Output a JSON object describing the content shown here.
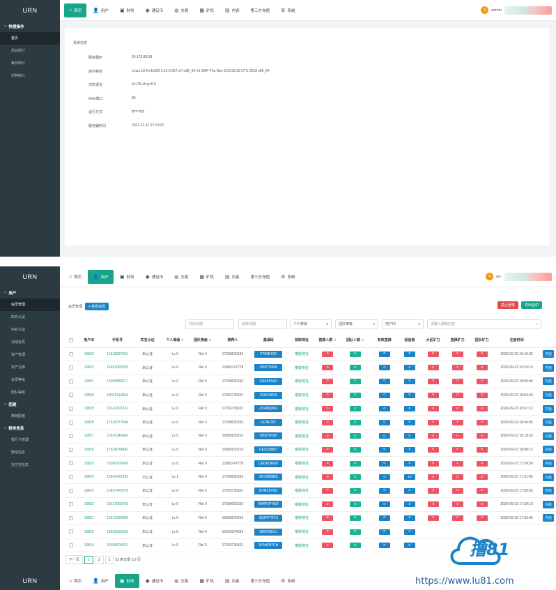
{
  "brand": "URN",
  "nav_tabs": [
    {
      "label": "首页",
      "icon": "home-icon"
    },
    {
      "label": "用户",
      "icon": "user-icon"
    },
    {
      "label": "财务",
      "icon": "finance-icon"
    },
    {
      "label": "通证币",
      "icon": "database-icon"
    },
    {
      "label": "交易",
      "icon": "exchange-icon"
    },
    {
      "label": "矿机",
      "icon": "table-icon"
    },
    {
      "label": "内容",
      "icon": "list-icon"
    },
    {
      "label": "第三方充值",
      "icon": ""
    },
    {
      "label": "系统",
      "icon": "gear-icon"
    }
  ],
  "user": {
    "name_1": "admin",
    "name_2": "ad-",
    "avatar": "a"
  },
  "sidebar_1": {
    "group": "快捷操作",
    "items": [
      "首页",
      "后台统计",
      "每日统计",
      "币种统计"
    ]
  },
  "sidebar_2": {
    "groups": [
      {
        "title": "用户",
        "items": [
          "会员管理",
          "四办认证",
          "实名认证",
          "冻结会员",
          "资产管理",
          "资产兑换",
          "会员等级",
          "团队等级"
        ]
      },
      {
        "title": "团建",
        "items": [
          "推荐图谱"
        ]
      },
      {
        "title": "财务信息",
        "items": [
          "银行卡管理",
          "微信信息",
          "支付宝信息"
        ]
      }
    ]
  },
  "system_info": {
    "title": "系统信息",
    "rows": [
      {
        "label": "服务器IP",
        "value": "59.176.89.58"
      },
      {
        "label": "操作系统",
        "value": "Linux 10-0-nfo025 3.10.0-957.el7.x86_64 #1 SMP Thu Nov 8 23:39:32 UTC 2018 x86_64"
      },
      {
        "label": "浏览语言",
        "value": "zh-CN,zh;q=0.9"
      },
      {
        "label": "Web端口",
        "value": "80"
      },
      {
        "label": "运行方式",
        "value": "fpm-fcgi"
      },
      {
        "label": "服务器时间",
        "value": "2021-01-11 17:13:02"
      }
    ]
  },
  "members": {
    "breadcrumb": "会员管理",
    "add_label": "新增会员",
    "ban_label": "禁止登录",
    "export_label": "导出选中",
    "filters": {
      "start_date": "开始日期",
      "end_date": "结束日期",
      "level": "个人等级",
      "team_level": "团队等级",
      "user_id": "用户ID",
      "search": "请输入搜索内容"
    },
    "columns": [
      "用户ID",
      "手机号",
      "实名认证",
      "个人等级",
      "团队等级",
      "推荐人",
      "邀请码",
      "领取地址",
      "直推人数",
      "团队人数",
      "有效直推",
      "经验值",
      "大区矿力",
      "直推矿力",
      "团队矿力",
      "注册时间"
    ],
    "op_label": "开启",
    "rows": [
      {
        "id": "10833",
        "phone": "13128887963",
        "auth": "未认证",
        "lv": "Lv 0",
        "team": "Rel 0",
        "ref": "17339000166",
        "code": "P769NICR",
        "addr": "複製地址",
        "a": "0",
        "b": "0",
        "c": "0",
        "d": "0",
        "e": "0",
        "f": "0",
        "g": "0",
        "time": "2020-09-23 19:43:32"
      },
      {
        "id": "10832",
        "phone": "15392090235",
        "auth": "未认证",
        "lv": "Lv 0",
        "team": "Rel 0",
        "ref": "13383747778",
        "code": "5I5PTI0RB",
        "addr": "複製地址",
        "a": "0",
        "b": "0",
        "c": "0",
        "d": "0",
        "e": "0",
        "f": "0",
        "g": "0",
        "time": "2020-09-23 19:24:15"
      },
      {
        "id": "10831",
        "phone": "13099885617",
        "auth": "未认证",
        "lv": "Lv 0",
        "team": "Rel 0",
        "ref": "17339000166",
        "code": "G8AZ5SA2",
        "addr": "複製地址",
        "a": "0",
        "b": "0",
        "c": "0",
        "d": "0",
        "e": "0",
        "f": "0",
        "g": "0",
        "time": "2020-09-23 18:55:44"
      },
      {
        "id": "10830",
        "phone": "18075114853",
        "auth": "未认证",
        "lv": "Lv 0",
        "team": "Rel 0",
        "ref": "17263739102",
        "code": "E5S019OS",
        "addr": "複製地址",
        "a": "0",
        "b": "0",
        "c": "0",
        "d": "0",
        "e": "0",
        "f": "0",
        "g": "0",
        "time": "2020-09-23 18:53:43"
      },
      {
        "id": "10829",
        "phone": "13142307241",
        "auth": "未认证",
        "lv": "Lv 0",
        "team": "Rel 0",
        "ref": "17263739102",
        "code": "JCEMQ50F",
        "addr": "複製地址",
        "a": "0",
        "b": "0",
        "c": "0",
        "d": "0",
        "e": "0",
        "f": "0",
        "g": "0",
        "time": "2020-09-23 18:47:12"
      },
      {
        "id": "10828",
        "phone": "17630977848",
        "auth": "未认证",
        "lv": "Lv 0",
        "team": "Rel 0",
        "ref": "17339000166",
        "code": "UCAE75T",
        "addr": "複製地址",
        "a": "0",
        "b": "0",
        "c": "0",
        "d": "0",
        "e": "0",
        "f": "0",
        "g": "0",
        "time": "2020-09-23 18:44:35"
      },
      {
        "id": "10827",
        "phone": "13610349666",
        "auth": "未认证",
        "lv": "Lv 0",
        "team": "Rel 0",
        "ref": "15993675210",
        "code": "65U0YKK0",
        "addr": "複製地址",
        "a": "0",
        "b": "0",
        "c": "0",
        "d": "0",
        "e": "0",
        "f": "0",
        "g": "0",
        "time": "2020-09-23 18:18:53"
      },
      {
        "id": "10826",
        "phone": "17634074842",
        "auth": "未认证",
        "lv": "Lv 0",
        "team": "Rel 0",
        "ref": "15993675210",
        "code": "CESZIMWT",
        "addr": "複製地址",
        "a": "0",
        "b": "0",
        "c": "0",
        "d": "0",
        "e": "0",
        "f": "0",
        "g": "0",
        "time": "2020-09-23 18:08:12"
      },
      {
        "id": "10825",
        "phone": "15089765049",
        "auth": "未认证",
        "lv": "Lv 0",
        "team": "Rel 0",
        "ref": "13383747778",
        "code": "CEDKOENU",
        "addr": "複製地址",
        "a": "0",
        "b": "0",
        "c": "0",
        "d": "0",
        "e": "0",
        "f": "0",
        "g": "0",
        "time": "2020-09-23 17:58:30"
      },
      {
        "id": "10824",
        "phone": "13243431343",
        "auth": "已认证",
        "lv": "Lv 1",
        "team": "Rel 0",
        "ref": "17339000166",
        "code": "0G7ZBMEB",
        "addr": "複製地址",
        "a": "0",
        "b": "0",
        "c": "0",
        "d": "10",
        "e": "0",
        "f": "0",
        "g": "0",
        "time": "2020-09-23 17:51:42"
      },
      {
        "id": "10823",
        "phone": "13837462970",
        "auth": "未认证",
        "lv": "Lv 0",
        "team": "Rel 0",
        "ref": "17263739102",
        "code": "BVRX5V0U",
        "addr": "複製地址",
        "a": "0",
        "b": "0",
        "c": "0",
        "d": "0",
        "e": "0",
        "f": "0",
        "g": "0",
        "time": "2020-09-23 17:50:55"
      },
      {
        "id": "10822",
        "phone": "19127060735",
        "auth": "未认证",
        "lv": "Lv 0",
        "team": "Rel 0",
        "ref": "17339000166",
        "code": "WHPKPYBO",
        "addr": "複製地址",
        "a": "0",
        "b": "0",
        "c": "0",
        "d": "0",
        "e": "0",
        "f": "0",
        "g": "0",
        "time": "2020-09-23 17:39:19"
      },
      {
        "id": "10821",
        "phone": "13213384899",
        "auth": "未认证",
        "lv": "Lv 0",
        "team": "Rel 0",
        "ref": "15993675210",
        "code": "SQIFP70YS",
        "addr": "複製地址",
        "a": "0",
        "b": "0",
        "c": "0",
        "d": "0",
        "e": "0",
        "f": "0",
        "g": "0",
        "time": "2020-09-23 17:33:06"
      },
      {
        "id": "10820",
        "phone": "18625993033",
        "auth": "未认证",
        "lv": "Lv 0",
        "team": "Rel 0",
        "ref": "15250274339",
        "code": "G85CRDLJ",
        "addr": "複製地址",
        "a": "0",
        "b": "0",
        "c": "0",
        "d": "0",
        "e": "",
        "f": "",
        "g": "",
        "time": ""
      },
      {
        "id": "10819",
        "phone": "15308004251",
        "auth": "未认证",
        "lv": "Lv 0",
        "team": "Rel 0",
        "ref": "17263739102",
        "code": "1KNWN7CH",
        "addr": "複製地址",
        "a": "0",
        "b": "0",
        "c": "0",
        "d": "0",
        "e": "",
        "f": "",
        "g": "",
        "time": ""
      }
    ],
    "pager": {
      "prev": "下一页",
      "pages": [
        "1",
        "2",
        "3"
      ],
      "summary": "33 条记录 1/3 页"
    }
  },
  "watermark": {
    "text": "撸81",
    "url": "https://www.lu81.com"
  }
}
